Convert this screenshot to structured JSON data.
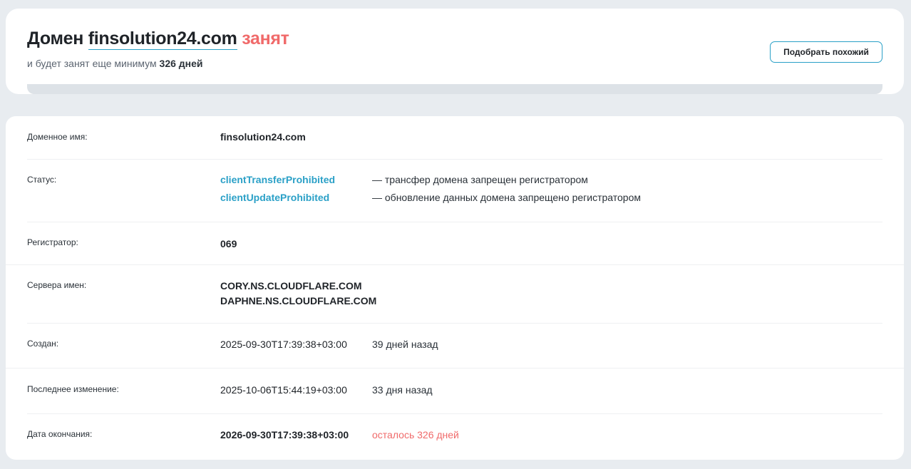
{
  "header": {
    "title_prefix": "Домен",
    "domain": "finsolution24.com",
    "status_word": "занят",
    "subtitle_prefix": "и будет занят еще минимум",
    "days_left": "326 дней",
    "similar_button": "Подобрать похожий"
  },
  "details": {
    "domain_name": {
      "label": "Доменное имя:",
      "value": "finsolution24.com"
    },
    "status": {
      "label": "Статус:",
      "items": [
        {
          "code": "clientTransferProhibited",
          "description": "— трансфер домена запрещен регистратором"
        },
        {
          "code": "clientUpdateProhibited",
          "description": "— обновление данных домена запрещено регистратором"
        }
      ]
    },
    "registrar": {
      "label": "Регистратор:",
      "value": "069"
    },
    "nameservers": {
      "label": "Сервера имен:",
      "values": [
        "CORY.NS.CLOUDFLARE.COM",
        "DAPHNE.NS.CLOUDFLARE.COM"
      ]
    },
    "created": {
      "label": "Создан:",
      "value": "2025-09-30T17:39:38+03:00",
      "note": "39 дней назад"
    },
    "updated": {
      "label": "Последнее изменение:",
      "value": "2025-10-06T15:44:19+03:00",
      "note": "33 дня назад"
    },
    "expires": {
      "label": "Дата окончания:",
      "value": "2026-09-30T17:39:38+03:00",
      "note": "осталось 326 дней"
    }
  },
  "colors": {
    "accent": "#2aa0c7",
    "busy": "#f06a6a",
    "background": "#e8ecf0"
  }
}
